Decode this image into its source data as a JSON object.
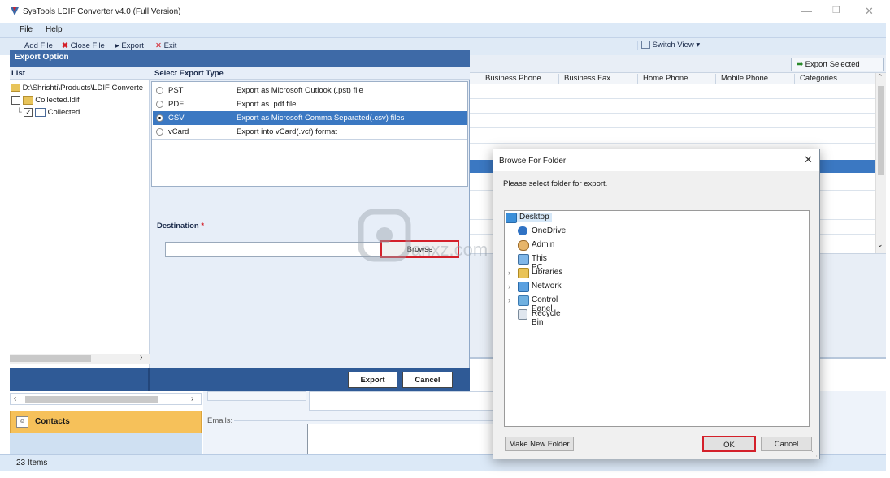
{
  "app": {
    "title": "SysTools LDIF Converter v4.0 (Full Version)",
    "menu": [
      "File",
      "Help"
    ],
    "toolbar": {
      "add_file": "Add File",
      "close_file": "Close File",
      "export": "Export",
      "exit": "Exit",
      "switch_view": "Switch View"
    },
    "export_selected": "Export Selected",
    "columns": [
      "Business Phone",
      "Business Fax",
      "Home Phone",
      "Mobile Phone",
      "Categories"
    ],
    "status": "23 Items",
    "contacts_label": "Contacts",
    "emails_label": "Emails:"
  },
  "export_dialog": {
    "title": "Export Option",
    "list_header": "List",
    "type_header": "Select Export Type",
    "tree": {
      "root": "D:\\Shrishti\\Products\\LDIF Converte",
      "child": "Collected.ldif",
      "grandchild": "Collected"
    },
    "types": [
      {
        "name": "PST",
        "desc": "Export as Microsoft Outlook (.pst) file",
        "selected": false
      },
      {
        "name": "PDF",
        "desc": "Export as .pdf file",
        "selected": false
      },
      {
        "name": "CSV",
        "desc": "Export as Microsoft Comma Separated(.csv) files",
        "selected": true
      },
      {
        "name": "vCard",
        "desc": "Export into vCard(.vcf) format",
        "selected": false
      }
    ],
    "destination_label": "Destination",
    "required_mark": "*",
    "destination_value": "",
    "browse": "Browse",
    "export_btn": "Export",
    "cancel_btn": "Cancel"
  },
  "browse_dialog": {
    "title": "Browse For Folder",
    "prompt": "Please select folder for export.",
    "items": [
      {
        "label": "Desktop",
        "expandable": false,
        "selected": true,
        "icon": "desktop-icon"
      },
      {
        "label": "OneDrive",
        "expandable": false,
        "selected": false,
        "icon": "cloud-icon"
      },
      {
        "label": "Admin",
        "expandable": false,
        "selected": false,
        "icon": "user-icon"
      },
      {
        "label": "This PC",
        "expandable": false,
        "selected": false,
        "icon": "computer-icon"
      },
      {
        "label": "Libraries",
        "expandable": true,
        "selected": false,
        "icon": "library-icon"
      },
      {
        "label": "Network",
        "expandable": true,
        "selected": false,
        "icon": "network-icon"
      },
      {
        "label": "Control Panel",
        "expandable": true,
        "selected": false,
        "icon": "control-panel-icon"
      },
      {
        "label": "Recycle Bin",
        "expandable": false,
        "selected": false,
        "icon": "recycle-bin-icon"
      }
    ],
    "make_new_folder": "Make New Folder",
    "ok": "OK",
    "cancel": "Cancel"
  },
  "watermark": {
    "text": "anxz.com"
  },
  "colors": {
    "accent": "#3e6aa7",
    "selection": "#3b78c2",
    "highlight_box": "#d4202a",
    "contacts_bg": "#f6c15a"
  }
}
